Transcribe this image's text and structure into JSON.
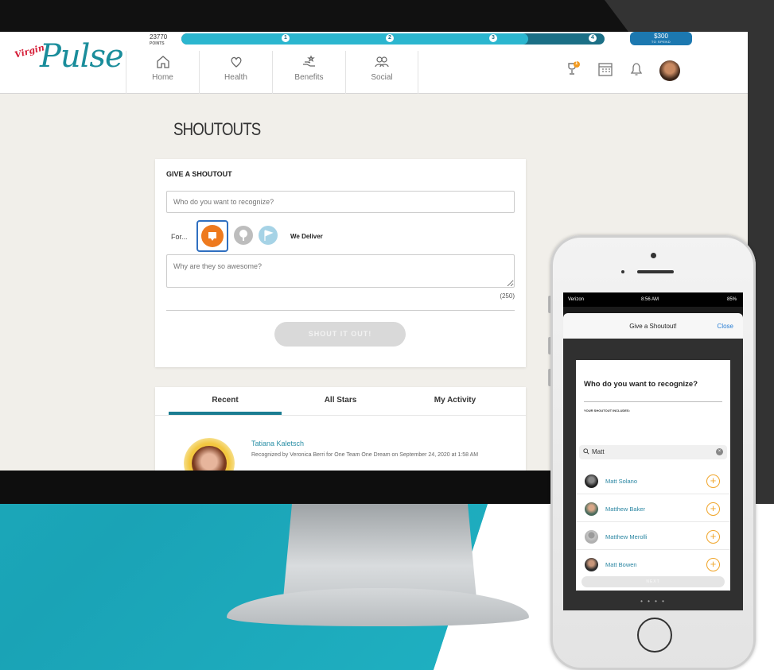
{
  "desktop": {
    "logo": {
      "small": "Virgin",
      "main": "Pulse"
    },
    "points": {
      "value": "23770",
      "label": "POINTS"
    },
    "progress": {
      "fraction": 0.82,
      "milestones": [
        "1",
        "2",
        "3",
        "4"
      ]
    },
    "reward": {
      "amount": "$300",
      "sub": "TO SPEND"
    },
    "nav": [
      {
        "label": "Home",
        "icon": "home-icon"
      },
      {
        "label": "Health",
        "icon": "heart-icon"
      },
      {
        "label": "Benefits",
        "icon": "hand-benefits-icon"
      },
      {
        "label": "Social",
        "icon": "people-icon"
      }
    ],
    "header_icons": [
      "trophy-icon",
      "calendar-icon",
      "bell-icon",
      "profile-avatar"
    ],
    "trophy_badge": "1",
    "page_title": "SHOUTOUTS",
    "give": {
      "heading": "GIVE A SHOUTOUT",
      "who_placeholder": "Who do you want to recognize?",
      "for_label": "For...",
      "selected_badge": "We Deliver",
      "why_placeholder": "Why are they so awesome?",
      "char_count": "(250)",
      "submit": "SHOUT IT OUT!"
    },
    "tabs": [
      {
        "label": "Recent",
        "active": true
      },
      {
        "label": "All Stars",
        "active": false
      },
      {
        "label": "My Activity",
        "active": false
      }
    ],
    "recent": {
      "name": "Tatiana Kaletsch",
      "text": "Recognized by Veronica Berri for One Team One Dream on September 24, 2020 at 1:58 AM"
    }
  },
  "phone": {
    "status": {
      "carrier": "Verizon",
      "time": "8:56 AM",
      "battery": "85%"
    },
    "modal_title": "Give a Shoutout!",
    "close": "Close",
    "question": "Who do you want to recognize?",
    "includes": "YOUR SHOUTOUT INCLUDES:",
    "search_value": "Matt",
    "results": [
      {
        "name": "Matt Solano"
      },
      {
        "name": "Matthew Baker"
      },
      {
        "name": "Matthew Merolli"
      },
      {
        "name": "Matt Bowen"
      }
    ],
    "next": "NEXT"
  },
  "colors": {
    "teal": "#1fb3c1",
    "brand_teal": "#1a8d9b",
    "badge_orange": "#ee7a1e",
    "add_orange": "#f0a52a",
    "link_teal": "#2a86a2"
  }
}
